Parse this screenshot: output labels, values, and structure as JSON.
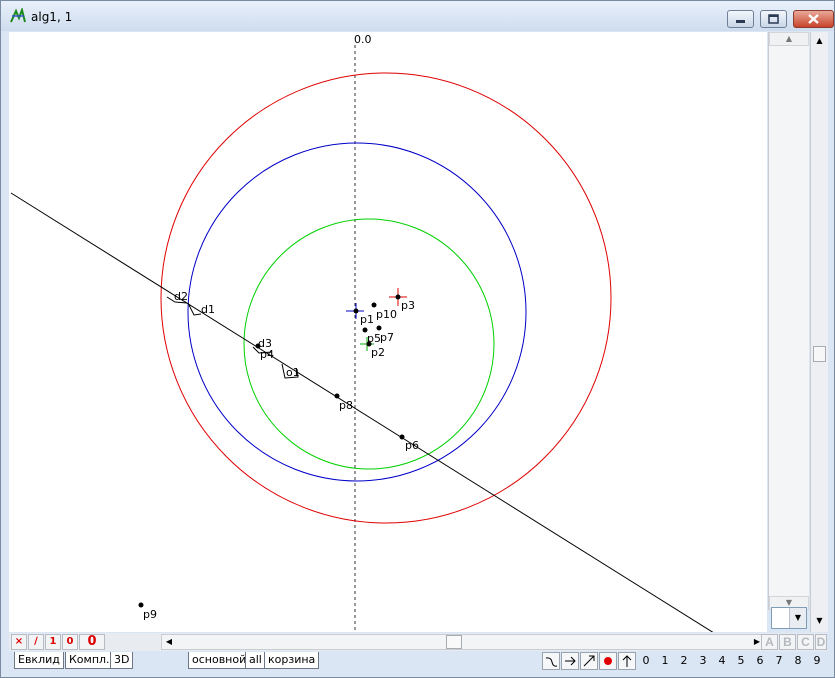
{
  "window": {
    "title": "alg1, 1"
  },
  "canvas": {
    "axis_label": "0.0",
    "points": [
      {
        "name": "p1",
        "label": "p1"
      },
      {
        "name": "p2",
        "label": "p2"
      },
      {
        "name": "p3",
        "label": "p3"
      },
      {
        "name": "p4",
        "label": "p4"
      },
      {
        "name": "p5",
        "label": "p5"
      },
      {
        "name": "p6",
        "label": "p6"
      },
      {
        "name": "p7",
        "label": "p7"
      },
      {
        "name": "p8",
        "label": "p8"
      },
      {
        "name": "p9",
        "label": "p9"
      },
      {
        "name": "p10",
        "label": "p10"
      }
    ],
    "markers": {
      "d1": "d1",
      "d2": "d2",
      "d3": "d3",
      "o1": "o1"
    },
    "colors": {
      "outer_circle": "#e00000",
      "middle_circle": "#0000c8",
      "inner_circle": "#00d000",
      "line": "#000000"
    }
  },
  "status": {
    "btn_x": "×",
    "btn_slash": "∕",
    "btn_1": "1",
    "btn_0a": "0",
    "btn_0b": "0"
  },
  "letters": [
    "A",
    "B",
    "C",
    "D"
  ],
  "tabs": {
    "left": [
      "Евклид",
      "Компл.",
      "3D"
    ],
    "right": [
      "основной",
      "all",
      "корзина"
    ]
  },
  "digits": [
    "0",
    "1",
    "2",
    "3",
    "4",
    "5",
    "6",
    "7",
    "8",
    "9"
  ]
}
